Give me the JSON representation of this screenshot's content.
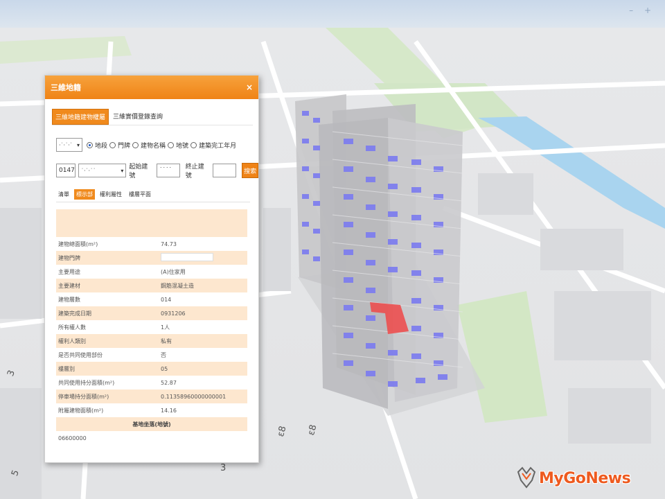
{
  "map": {
    "controls": "– +",
    "road_labels": [
      "ε8",
      "ε8",
      "3",
      "5",
      "3"
    ]
  },
  "panel": {
    "title": "三維地籍",
    "close": "×",
    "tabs": [
      {
        "label": "三維地籍建物權屬",
        "active": true
      },
      {
        "label": "三維實價登錄查詢",
        "active": false
      }
    ],
    "search": {
      "city_select": "·˙·˙·˙",
      "radios": [
        {
          "label": "地段",
          "checked": true
        },
        {
          "label": "門牌",
          "checked": false
        },
        {
          "label": "建物名稱",
          "checked": false
        },
        {
          "label": "地號",
          "checked": false
        },
        {
          "label": "建築完工年月",
          "checked": false
        }
      ],
      "code_value": "0147",
      "section_select": "˙·˙·˙˙",
      "start_label": "起始建號",
      "start_value": "˙˙˙˙",
      "end_label": "終止建號",
      "end_value": "",
      "button": "搜索"
    },
    "subtabs": [
      {
        "label": "清單",
        "active": false
      },
      {
        "label": "標示部",
        "active": true
      },
      {
        "label": "權利屬性",
        "active": false
      },
      {
        "label": "樓層平面",
        "active": false
      }
    ],
    "rows": [
      {
        "label": "建物總面積(m²)",
        "value": "74.73"
      },
      {
        "label": "建物門牌",
        "value": ""
      },
      {
        "label": "主要用途",
        "value": "(A)住家用"
      },
      {
        "label": "主要建材",
        "value": "鋼筋混凝土造"
      },
      {
        "label": "建物層數",
        "value": "014"
      },
      {
        "label": "建築完成日期",
        "value": "0931206"
      },
      {
        "label": "所有權人數",
        "value": "1人"
      },
      {
        "label": "權利人類別",
        "value": "私有"
      },
      {
        "label": "是否共同使用部份",
        "value": "否"
      },
      {
        "label": "樓層別",
        "value": "05"
      },
      {
        "label": "共同使用持分面積(m²)",
        "value": "52.87"
      },
      {
        "label": "停車場持分面積(m²)",
        "value": "0.11358960000000001"
      },
      {
        "label": "附屬建物面積(m²)",
        "value": "14.16"
      }
    ],
    "section_title": "基地坐落(地號)",
    "land_no": "06600000"
  },
  "watermark": {
    "brand": "MyGoNews",
    "brand_color": "#ee5a1f"
  }
}
